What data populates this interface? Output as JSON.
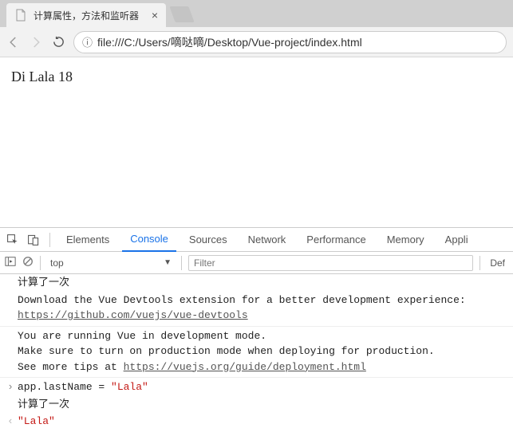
{
  "browser": {
    "tab_title": "计算属性，方法和监听器",
    "url": "file:///C:/Users/嘀哒嘀/Desktop/Vue-project/index.html"
  },
  "page": {
    "content": "Di Lala 18"
  },
  "devtools": {
    "tabs": {
      "elements": "Elements",
      "console": "Console",
      "sources": "Sources",
      "network": "Network",
      "performance": "Performance",
      "memory": "Memory",
      "application": "Appli"
    },
    "toolbar": {
      "context": "top",
      "filter_placeholder": "Filter",
      "default_levels": "Def"
    },
    "console_lines": {
      "l1": "计算了一次",
      "l2_text": "Download the Vue Devtools extension for a better development experience:",
      "l2_link": "https://github.com/vuejs/vue-devtools",
      "l3a": "You are running Vue in development mode.",
      "l3b": "Make sure to turn on production mode when deploying for production.",
      "l3c_pre": "See more tips at ",
      "l3c_link": "https://vuejs.org/guide/deployment.html",
      "l4_code": "app.lastName = ",
      "l4_str": "\"Lala\"",
      "l5": "计算了一次",
      "l6": "\"Lala\""
    }
  }
}
